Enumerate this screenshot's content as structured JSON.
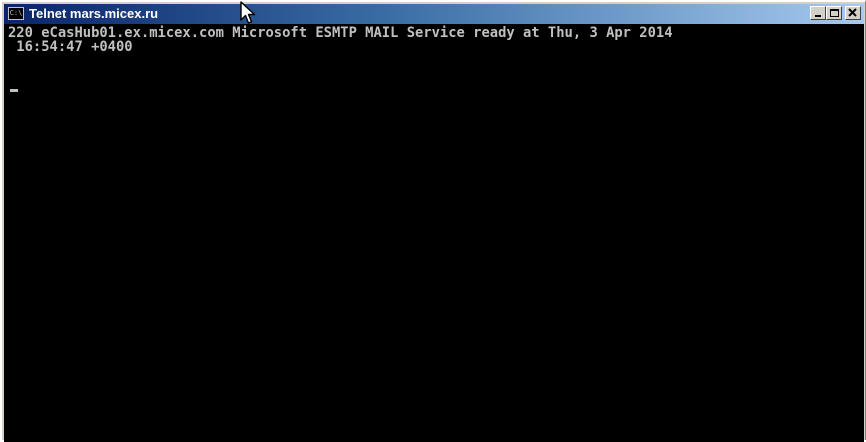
{
  "window": {
    "title": "Telnet mars.micex.ru",
    "icon": "console-icon",
    "icon_text": "C:\\"
  },
  "terminal": {
    "line1": "220 eCasHub01.ex.micex.com Microsoft ESMTP MAIL Service ready at Thu, 3 Apr 2014",
    "line2": " 16:54:47 +0400"
  },
  "colors": {
    "title_gradient_start": "#0a246a",
    "title_gradient_end": "#a6caf0",
    "terminal_bg": "#000000",
    "terminal_fg": "#c0c0c0"
  }
}
